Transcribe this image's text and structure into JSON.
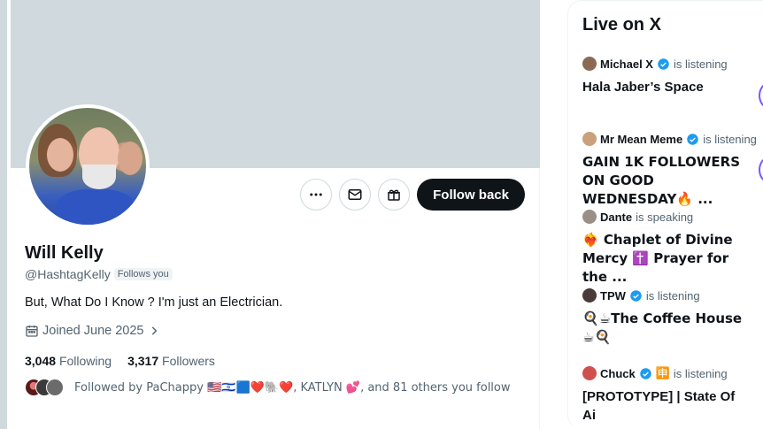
{
  "profile": {
    "name": "Will Kelly",
    "handle": "@HashtagKelly",
    "follows_you_badge": "Follows you",
    "bio": "But, What Do I Know ? I'm just an Electrician.",
    "joined": "Joined June 2025",
    "following_count": "3,048",
    "following_label": "Following",
    "followers_count": "3,317",
    "followers_label": "Followers",
    "followed_by": "Followed by PaChappy 🇺🇸🇮🇱🟦❤️🐘❤️, KATLYN 💕, and 81 others you follow",
    "follow_button": "Follow back"
  },
  "icons": {
    "more": "more-icon",
    "message": "envelope-icon",
    "gift": "gift-icon",
    "calendar": "calendar-icon",
    "chevron": "chevron-right-icon",
    "verified": "verified-badge-icon"
  },
  "colors": {
    "banner": "#cfd9de",
    "follow_button_bg": "#0f1419",
    "verified": "#1d9bf0",
    "spaces_accent": "#7856ff"
  },
  "sidebar": {
    "title": "Live on X",
    "items": [
      {
        "host": "Michael X",
        "verified": true,
        "status": "is listening",
        "title": "Hala Jaber’s Space"
      },
      {
        "host": "Mr Mean Meme",
        "verified": true,
        "status": "is listening",
        "title": "GAIN 1K FOLLOWERS ON GOOD WEDNESDAY🔥 ..."
      },
      {
        "host": "Dante",
        "verified": false,
        "status": "is speaking",
        "title": "❤️‍🔥 Chaplet of Divine Mercy ✝️ Prayer for the ..."
      },
      {
        "host": "TPW",
        "verified": true,
        "status": "is listening",
        "title": "🍳☕The Coffee House☕🍳"
      },
      {
        "host": "Chuck",
        "verified": true,
        "extra": "🈸",
        "status": "is listening",
        "title": "[PROTOTYPE] | State Of Ai"
      }
    ]
  }
}
